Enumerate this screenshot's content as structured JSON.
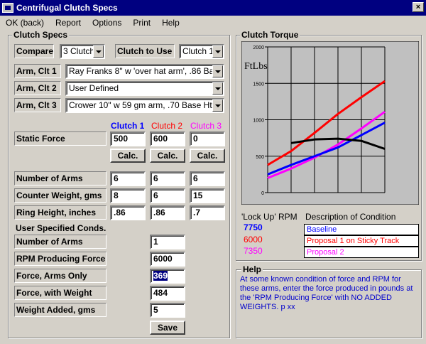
{
  "window": {
    "title": "Centrifugal Clutch Specs",
    "close": "×"
  },
  "menu": [
    "OK (back)",
    "Report",
    "Options",
    "Print",
    "Help"
  ],
  "specs": {
    "title": "Clutch Specs",
    "compare_label": "Compare",
    "compare_value": "3 Clutches",
    "clutch_to_use_label": "Clutch to Use",
    "clutch_to_use_value": "Clutch 1",
    "arm1_label": "Arm, Clt 1",
    "arm1_value": "Ray Franks 8\" w 'over hat arm', .86 Base Ht",
    "arm2_label": "Arm, Clt 2",
    "arm2_value": "User Defined",
    "arm3_label": "Arm, Clt 3",
    "arm3_value": "Crower 10\" w 59 gm arm, .70 Base Ht",
    "col_headers": [
      "Clutch 1",
      "Clutch 2",
      "Clutch 3"
    ],
    "col_colors": [
      "#0000ff",
      "#ff0000",
      "#ff00ff"
    ],
    "static_force_label": "Static Force",
    "static_force": [
      "500",
      "600",
      "0"
    ],
    "calc_label": "Calc.",
    "num_arms_label": "Number of Arms",
    "num_arms": [
      "6",
      "6",
      "6"
    ],
    "counter_weight_label": "Counter Weight, gms",
    "counter_weight": [
      "8",
      "6",
      "15"
    ],
    "ring_height_label": "Ring Height, inches",
    "ring_height": [
      ".86",
      ".86",
      ".7"
    ]
  },
  "user": {
    "title": "User Specified Conds.",
    "num_arms_label": "Number of Arms",
    "num_arms": "1",
    "rpm_label": "RPM Producing Force",
    "rpm": "6000",
    "force_arms_label": "Force, Arms Only",
    "force_arms": "369",
    "force_weight_label": "Force, with Weight",
    "force_weight": "484",
    "weight_added_label": "Weight Added, gms",
    "weight_added": "5",
    "save_label": "Save"
  },
  "torque": {
    "title": "Clutch Torque",
    "lockup_label": "'Lock Up' RPM",
    "desc_label": "Description of Condition",
    "lockups": [
      "7750",
      "6000",
      "7350"
    ],
    "descriptions": [
      "Baseline",
      "Proposal 1 on Sticky Track",
      "Proposal 2"
    ]
  },
  "help": {
    "title": "Help",
    "text": "At some known condition of force and RPM for these arms, enter the force produced in pounds at the 'RPM Producing Force' with NO ADDED WEIGHTS.  p xx"
  },
  "chart_data": {
    "type": "line",
    "ylabel": "FtLbs",
    "ylim": [
      0,
      2000
    ],
    "yticks": [
      "2000",
      "1500",
      "1000",
      "500",
      "0"
    ],
    "x": [
      0,
      1,
      2,
      3,
      4,
      5
    ],
    "series": [
      {
        "color": "#ff0000",
        "values": [
          380,
          570,
          820,
          1080,
          1310,
          1530
        ]
      },
      {
        "color": "#ff00ff",
        "values": [
          200,
          330,
          480,
          660,
          880,
          1110
        ]
      },
      {
        "color": "#0000ff",
        "values": [
          250,
          380,
          500,
          620,
          790,
          960
        ]
      },
      {
        "color": "#000000",
        "x": [
          1,
          2,
          3,
          4,
          5
        ],
        "values": [
          680,
          730,
          740,
          710,
          600
        ]
      }
    ]
  }
}
